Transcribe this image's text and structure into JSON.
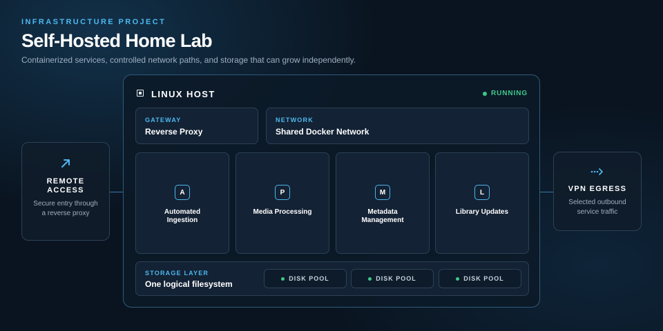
{
  "header": {
    "eyebrow": "INFRASTRUCTURE PROJECT",
    "title": "Self-Hosted Home Lab",
    "subtitle": "Containerized services, controlled network paths, and storage that can grow independently."
  },
  "remote_access": {
    "icon": "arrow-up-right-icon",
    "title": "REMOTE ACCESS",
    "description": "Secure entry through a reverse proxy"
  },
  "vpn_egress": {
    "icon": "dotted-arrow-right-icon",
    "title": "VPN EGRESS",
    "description": "Selected outbound service traffic"
  },
  "host": {
    "icon": "server-icon",
    "title": "LINUX HOST",
    "status": "RUNNING",
    "status_color": "#3ec98a",
    "gateway": {
      "kicker": "GATEWAY",
      "label": "Reverse Proxy"
    },
    "network": {
      "kicker": "NETWORK",
      "label": "Shared Docker Network"
    },
    "services": [
      {
        "badge": "A",
        "label": "Automated Ingestion"
      },
      {
        "badge": "P",
        "label": "Media Processing"
      },
      {
        "badge": "M",
        "label": "Metadata Management"
      },
      {
        "badge": "L",
        "label": "Library Updates"
      }
    ],
    "storage": {
      "kicker": "STORAGE LAYER",
      "label": "One logical filesystem",
      "pools": [
        "DISK POOL",
        "DISK POOL",
        "DISK POOL"
      ]
    }
  },
  "colors": {
    "accent": "#4cb8ef",
    "status": "#3ec98a",
    "background": "#0a1420"
  }
}
